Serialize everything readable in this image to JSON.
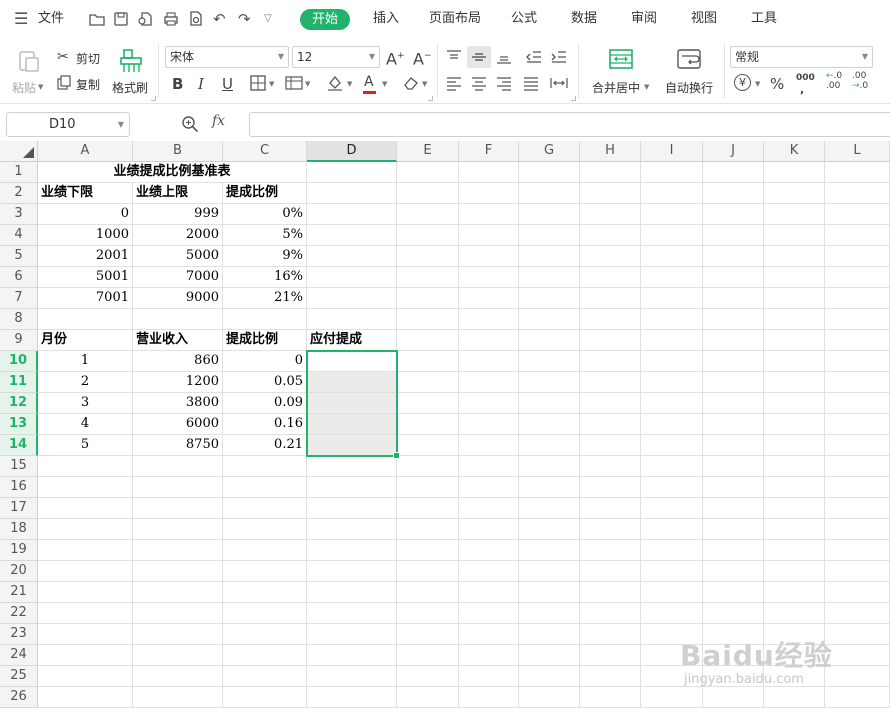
{
  "menu": {
    "file_label": "文件",
    "tabs": [
      "开始",
      "插入",
      "页面布局",
      "公式",
      "数据",
      "审阅",
      "视图",
      "工具"
    ],
    "active_tab": "开始"
  },
  "ribbon": {
    "paste_label": "粘贴",
    "cut_label": "剪切",
    "copy_label": "复制",
    "format_painter_label": "格式刷",
    "font_name": "宋体",
    "font_size": "12",
    "merge_center_label": "合并居中",
    "wrap_text_label": "自动换行",
    "number_format": "常规",
    "percent_glyph": "%",
    "thousands_glyph": "000",
    "inc_decimal_glyph": "+.0\n.00",
    "dec_decimal_glyph": ".00\n→.0",
    "accent_color": "#1fb36b",
    "font_color_bar": "#e02020"
  },
  "formula_bar": {
    "name_box": "D10",
    "fx_label": "fx",
    "formula": ""
  },
  "grid": {
    "columns": [
      "A",
      "B",
      "C",
      "D",
      "E",
      "F",
      "G",
      "H",
      "I",
      "J",
      "K",
      "L"
    ],
    "selected_column": "D",
    "rows": [
      "1",
      "2",
      "3",
      "4",
      "5",
      "6",
      "7",
      "8",
      "9",
      "10",
      "11",
      "12",
      "13",
      "14",
      "15",
      "16",
      "17",
      "18",
      "19",
      "20",
      "21",
      "22",
      "23",
      "24",
      "25",
      "26"
    ],
    "selected_rows": [
      "10",
      "11",
      "12",
      "13",
      "14"
    ],
    "title": "业绩提成比例基准表",
    "table1_headers": [
      "业绩下限",
      "业绩上限",
      "提成比例"
    ],
    "table1_rows": [
      [
        "0",
        "999",
        "0%"
      ],
      [
        "1000",
        "2000",
        "5%"
      ],
      [
        "2001",
        "5000",
        "9%"
      ],
      [
        "5001",
        "7000",
        "16%"
      ],
      [
        "7001",
        "9000",
        "21%"
      ]
    ],
    "table2_headers": [
      "月份",
      "营业收入",
      "提成比例",
      "应付提成"
    ],
    "table2_rows": [
      [
        "1",
        "860",
        "0",
        ""
      ],
      [
        "2",
        "1200",
        "0.05",
        ""
      ],
      [
        "3",
        "3800",
        "0.09",
        ""
      ],
      [
        "4",
        "6000",
        "0.16",
        ""
      ],
      [
        "5",
        "8750",
        "0.21",
        ""
      ]
    ]
  },
  "watermark": {
    "brand": "Baidu经验",
    "url": "jingyan.baidu.com"
  }
}
